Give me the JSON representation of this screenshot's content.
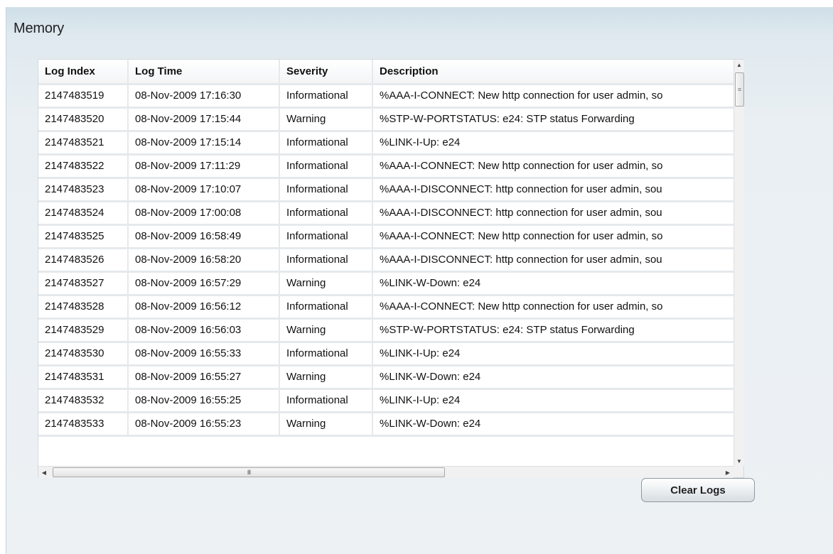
{
  "panel": {
    "title": "Memory"
  },
  "table": {
    "columns": [
      "Log Index",
      "Log Time",
      "Severity",
      "Description"
    ],
    "rows": [
      [
        "2147483519",
        "08-Nov-2009 17:16:30",
        "Informational",
        "%AAA-I-CONNECT: New http connection for user admin, so"
      ],
      [
        "2147483520",
        "08-Nov-2009 17:15:44",
        "Warning",
        "%STP-W-PORTSTATUS: e24: STP status Forwarding"
      ],
      [
        "2147483521",
        "08-Nov-2009 17:15:14",
        "Informational",
        "%LINK-I-Up:  e24"
      ],
      [
        "2147483522",
        "08-Nov-2009 17:11:29",
        "Informational",
        "%AAA-I-CONNECT: New http connection for user admin, so"
      ],
      [
        "2147483523",
        "08-Nov-2009 17:10:07",
        "Informational",
        "%AAA-I-DISCONNECT: http connection for user admin, sou"
      ],
      [
        "2147483524",
        "08-Nov-2009 17:00:08",
        "Informational",
        "%AAA-I-DISCONNECT: http connection for user admin, sou"
      ],
      [
        "2147483525",
        "08-Nov-2009 16:58:49",
        "Informational",
        "%AAA-I-CONNECT: New http connection for user admin, so"
      ],
      [
        "2147483526",
        "08-Nov-2009 16:58:20",
        "Informational",
        "%AAA-I-DISCONNECT: http connection for user admin, sou"
      ],
      [
        "2147483527",
        "08-Nov-2009 16:57:29",
        "Warning",
        "%LINK-W-Down:  e24"
      ],
      [
        "2147483528",
        "08-Nov-2009 16:56:12",
        "Informational",
        "%AAA-I-CONNECT: New http connection for user admin, so"
      ],
      [
        "2147483529",
        "08-Nov-2009 16:56:03",
        "Warning",
        "%STP-W-PORTSTATUS: e24: STP status Forwarding"
      ],
      [
        "2147483530",
        "08-Nov-2009 16:55:33",
        "Informational",
        "%LINK-I-Up:  e24"
      ],
      [
        "2147483531",
        "08-Nov-2009 16:55:27",
        "Warning",
        "%LINK-W-Down:  e24"
      ],
      [
        "2147483532",
        "08-Nov-2009 16:55:25",
        "Informational",
        "%LINK-I-Up:  e24"
      ],
      [
        "2147483533",
        "08-Nov-2009 16:55:23",
        "Warning",
        "%LINK-W-Down:  e24"
      ]
    ]
  },
  "scrollbars": {
    "vertical": {
      "up_icon": "arrow-up-icon",
      "down_icon": "arrow-down-icon",
      "thumb_grip": "≡"
    },
    "horizontal": {
      "left_icon": "arrow-left-icon",
      "right_icon": "arrow-right-icon",
      "thumb_grip": "III"
    }
  },
  "actions": {
    "clear_logs_label": "Clear Logs"
  }
}
